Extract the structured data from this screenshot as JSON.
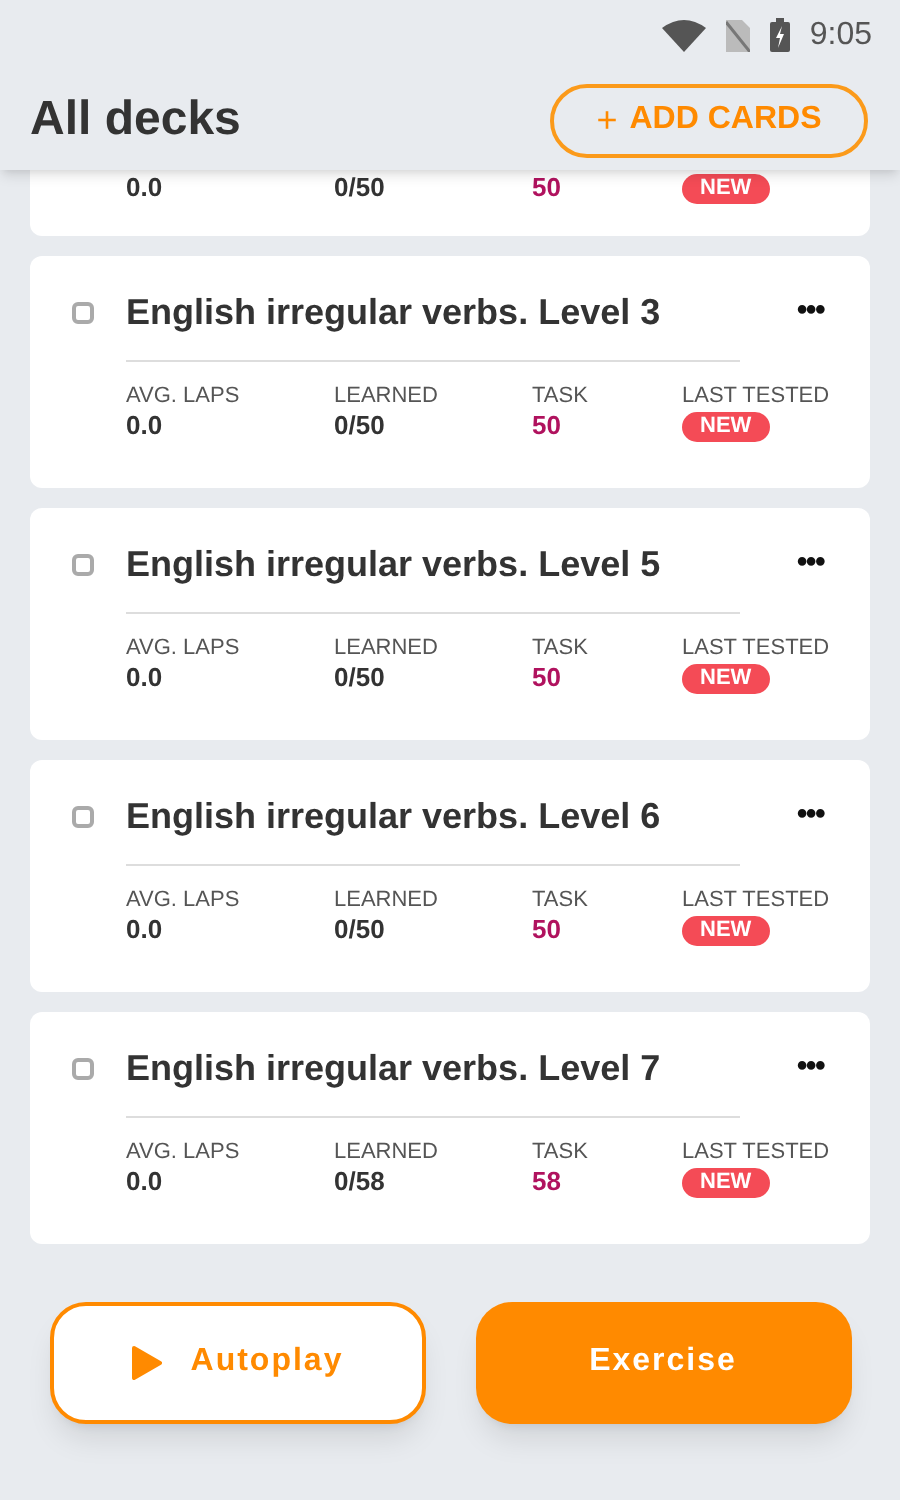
{
  "status_bar": {
    "time": "9:05"
  },
  "header": {
    "title": "All decks",
    "add_button": {
      "icon": "+",
      "label": "ADD CARDS"
    }
  },
  "partial_card": {
    "values": [
      "0.0",
      "0/50",
      "50"
    ],
    "badge": "NEW"
  },
  "decks": [
    {
      "title": "English irregular verbs. Level 3",
      "checked": false,
      "menu": "•••",
      "labels": [
        "AVG. LAPS",
        "LEARNED",
        "TASK",
        "LAST TESTED"
      ],
      "values": [
        "0.0",
        "0/50",
        "50"
      ],
      "badge": "NEW"
    },
    {
      "title": "English irregular verbs. Level 5",
      "checked": false,
      "menu": "•••",
      "labels": [
        "AVG. LAPS",
        "LEARNED",
        "TASK",
        "LAST TESTED"
      ],
      "values": [
        "0.0",
        "0/50",
        "50"
      ],
      "badge": "NEW"
    },
    {
      "title": "English irregular verbs. Level 6",
      "checked": false,
      "menu": "•••",
      "labels": [
        "AVG. LAPS",
        "LEARNED",
        "TASK",
        "LAST TESTED"
      ],
      "values": [
        "0.0",
        "0/50",
        "50"
      ],
      "badge": "NEW"
    },
    {
      "title": "English irregular verbs. Level 7",
      "checked": false,
      "menu": "•••",
      "labels": [
        "AVG. LAPS",
        "LEARNED",
        "TASK",
        "LAST TESTED"
      ],
      "values": [
        "0.0",
        "0/58",
        "58"
      ],
      "badge": "NEW"
    }
  ],
  "actions": [
    {
      "kind": "outline",
      "label": "Autoplay"
    },
    {
      "kind": "filled",
      "label": "Exercise"
    }
  ]
}
